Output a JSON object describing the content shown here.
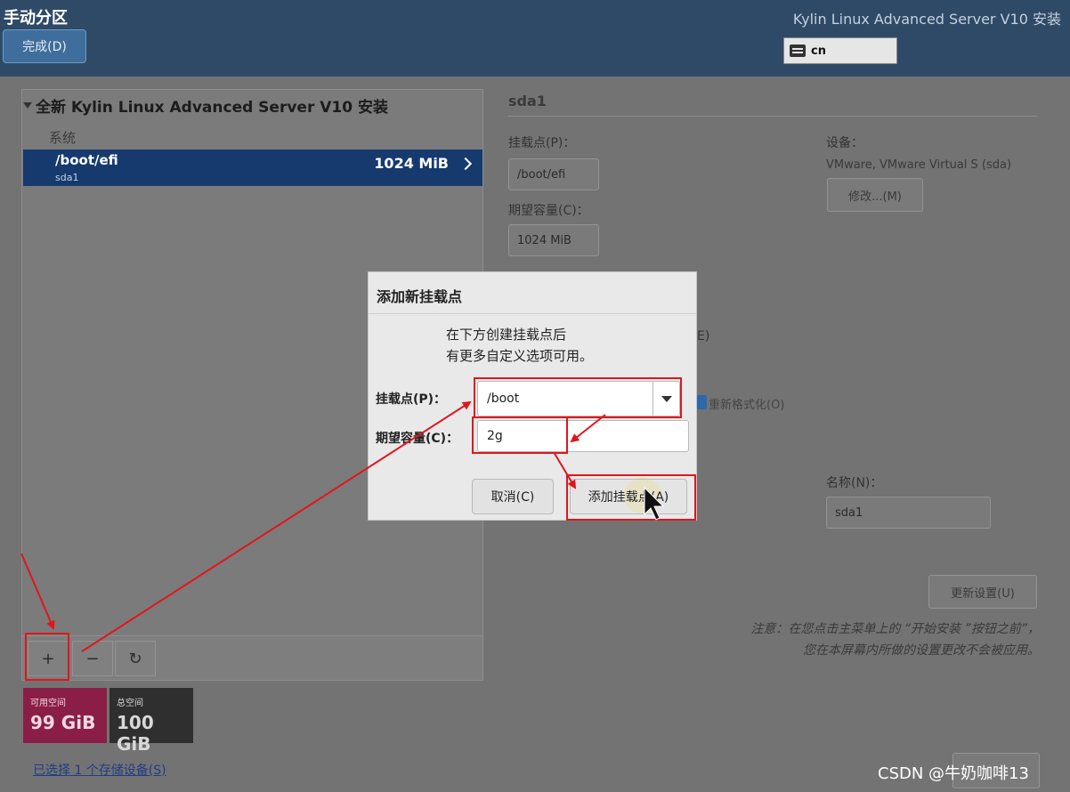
{
  "header": {
    "page_title": "手动分区",
    "done_button": "完成(D)",
    "product_title": "Kylin Linux Advanced Server V10 安装",
    "keyboard_layout": "cn"
  },
  "left_panel": {
    "install_title": "全新 Kylin Linux Advanced Server V10 安装",
    "section_label": "系统",
    "selected_partition": {
      "mount_point": "/boot/efi",
      "device": "sda1",
      "size": "1024 MiB"
    },
    "toolbar": {
      "add": "+",
      "remove": "−",
      "refresh": "↻"
    },
    "available_space": {
      "label": "可用空间",
      "value": "99 GiB"
    },
    "total_space": {
      "label": "总空间",
      "value": "100 GiB"
    },
    "storage_link": "已选择 1 个存储设备(S)"
  },
  "right_panel": {
    "device_heading": "sda1",
    "mount_point_label": "挂载点(P)：",
    "mount_point_value": "/boot/efi",
    "capacity_label": "期望容量(C)：",
    "capacity_value": "1024 MiB",
    "device_label": "设备：",
    "device_desc": "VMware, VMware Virtual S (sda)",
    "modify_button": "修改...(M)",
    "partial_text": "E)",
    "reformat_label": "重新格式化(O)",
    "name_label": "名称(N)：",
    "name_value": "sda1",
    "update_button": "更新设置(U)",
    "note": "注意：在您点击主菜单上的 “开始安装 ”按钮之前”，您在本屏幕内所做的设置更改不会被应用。"
  },
  "dialog": {
    "title": "添加新挂载点",
    "description_line1": "在下方创建挂载点后",
    "description_line2": "有更多自定义选项可用。",
    "mount_point_label": "挂载点(P)：",
    "mount_point_value": "/boot",
    "capacity_label": "期望容量(C)：",
    "capacity_value": "2g",
    "cancel_button": "取消(C)",
    "add_button": "添加挂载点(A)"
  },
  "watermark": "CSDN @牛奶咖啡13",
  "colors": {
    "header_bg": "#2f4a67",
    "selection_bg": "#163a6e",
    "available_space_bg": "#8a1e46",
    "annotation_red": "#e0161c"
  }
}
